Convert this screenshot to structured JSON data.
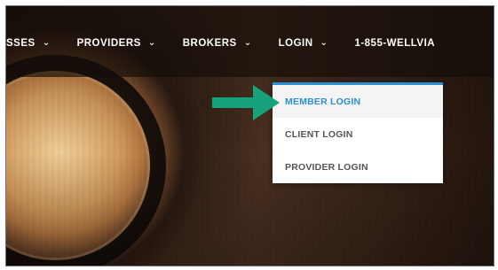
{
  "nav": {
    "items": [
      {
        "label": "SSES"
      },
      {
        "label": "PROVIDERS"
      },
      {
        "label": "BROKERS"
      },
      {
        "label": "LOGIN"
      }
    ],
    "phone": "1-855-WELLVIA"
  },
  "dropdown": {
    "items": [
      {
        "label": "MEMBER LOGIN",
        "active": true
      },
      {
        "label": "CLIENT LOGIN",
        "active": false
      },
      {
        "label": "PROVIDER LOGIN",
        "active": false
      }
    ]
  },
  "colors": {
    "accent_blue": "#2b8fd1",
    "arrow_green": "#16a37b",
    "menu_text": "#555555"
  },
  "icons": {
    "chevron": "chevron-down-icon",
    "pointer_arrow": "arrow-right-icon"
  }
}
